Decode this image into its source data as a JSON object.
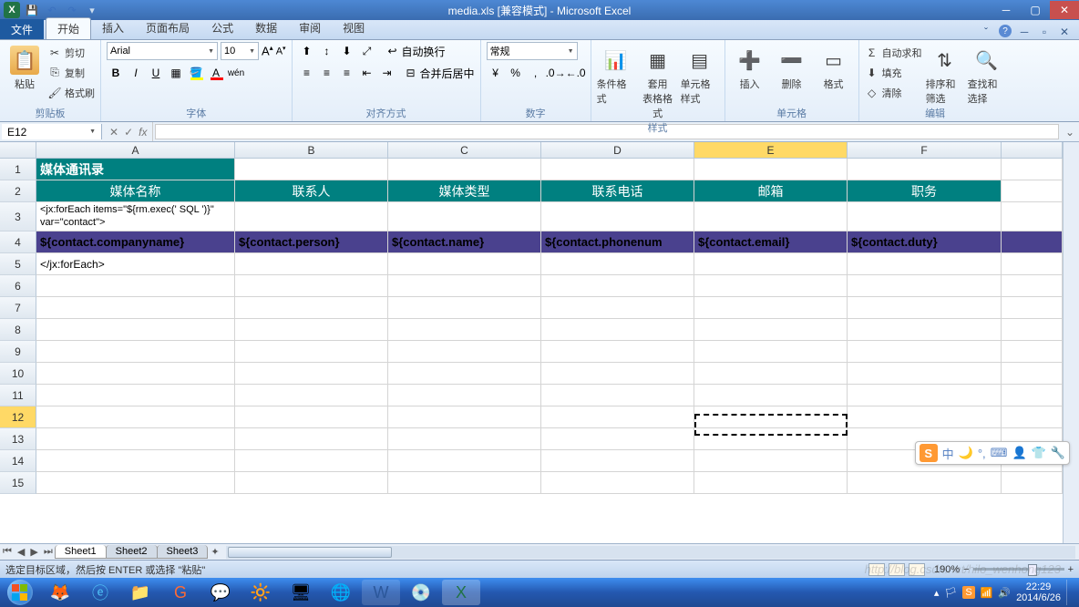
{
  "window": {
    "title": "media.xls [兼容模式] - Microsoft Excel"
  },
  "ribbon": {
    "file": "文件",
    "tabs": [
      "开始",
      "插入",
      "页面布局",
      "公式",
      "数据",
      "审阅",
      "视图"
    ],
    "active": 0,
    "groups": {
      "clipboard": {
        "label": "剪贴板",
        "paste": "粘贴",
        "cut": "剪切",
        "copy": "复制",
        "painter": "格式刷"
      },
      "font": {
        "label": "字体",
        "name": "Arial",
        "size": "10"
      },
      "align": {
        "label": "对齐方式",
        "wrap": "自动换行",
        "merge": "合并后居中"
      },
      "number": {
        "label": "数字",
        "format": "常规"
      },
      "styles": {
        "label": "样式",
        "cond": "条件格式",
        "table": "套用\n表格格式",
        "cell": "单元格样式"
      },
      "cells": {
        "label": "单元格",
        "insert": "插入",
        "delete": "删除",
        "format": "格式"
      },
      "editing": {
        "label": "编辑",
        "sum": "自动求和",
        "fill": "填充",
        "clear": "清除",
        "sort": "排序和筛选",
        "find": "查找和选择"
      }
    }
  },
  "formulaBar": {
    "nameBox": "E12",
    "fx": "fx",
    "value": ""
  },
  "grid": {
    "cols": [
      "A",
      "B",
      "C",
      "D",
      "E",
      "F"
    ],
    "selectedCol": "E",
    "selectedRow": 12,
    "rows": [
      {
        "n": 1,
        "h": 24,
        "cells": [
          {
            "t": "媒体通讯录",
            "cls": "teal"
          },
          {
            "t": ""
          },
          {
            "t": ""
          },
          {
            "t": ""
          },
          {
            "t": ""
          },
          {
            "t": ""
          }
        ]
      },
      {
        "n": 2,
        "h": 24,
        "cells": [
          {
            "t": "媒体名称",
            "cls": "teal-h"
          },
          {
            "t": "联系人",
            "cls": "teal-h"
          },
          {
            "t": "媒体类型",
            "cls": "teal-h"
          },
          {
            "t": "联系电话",
            "cls": "teal-h"
          },
          {
            "t": "邮箱",
            "cls": "teal-h"
          },
          {
            "t": "职务",
            "cls": "teal-h"
          }
        ]
      },
      {
        "n": 3,
        "h": 32,
        "cells": [
          {
            "t": "<jx:forEach items=\"${rm.exec(' SQL ')}\" var=\"contact\">",
            "wrap": true
          },
          {
            "t": ""
          },
          {
            "t": ""
          },
          {
            "t": ""
          },
          {
            "t": ""
          },
          {
            "t": ""
          }
        ]
      },
      {
        "n": 4,
        "h": 24,
        "cells": [
          {
            "t": "${contact.companyname}",
            "cls": "purple"
          },
          {
            "t": "${contact.person}",
            "cls": "purple"
          },
          {
            "t": "${contact.name}",
            "cls": "purple"
          },
          {
            "t": "${contact.phonenum",
            "cls": "purple"
          },
          {
            "t": "${contact.email}",
            "cls": "purple"
          },
          {
            "t": "${contact.duty}",
            "cls": "purple"
          }
        ]
      },
      {
        "n": 5,
        "h": 24,
        "cells": [
          {
            "t": "</jx:forEach>"
          },
          {
            "t": ""
          },
          {
            "t": ""
          },
          {
            "t": ""
          },
          {
            "t": ""
          },
          {
            "t": ""
          }
        ]
      },
      {
        "n": 6,
        "h": 24,
        "cells": [
          {
            "t": ""
          },
          {
            "t": ""
          },
          {
            "t": ""
          },
          {
            "t": ""
          },
          {
            "t": ""
          },
          {
            "t": ""
          }
        ]
      },
      {
        "n": 7,
        "h": 24,
        "cells": [
          {
            "t": ""
          },
          {
            "t": ""
          },
          {
            "t": ""
          },
          {
            "t": ""
          },
          {
            "t": ""
          },
          {
            "t": ""
          }
        ]
      },
      {
        "n": 8,
        "h": 24,
        "cells": [
          {
            "t": ""
          },
          {
            "t": ""
          },
          {
            "t": ""
          },
          {
            "t": ""
          },
          {
            "t": ""
          },
          {
            "t": ""
          }
        ]
      },
      {
        "n": 9,
        "h": 24,
        "cells": [
          {
            "t": ""
          },
          {
            "t": ""
          },
          {
            "t": ""
          },
          {
            "t": ""
          },
          {
            "t": ""
          },
          {
            "t": ""
          }
        ]
      },
      {
        "n": 10,
        "h": 24,
        "cells": [
          {
            "t": ""
          },
          {
            "t": ""
          },
          {
            "t": ""
          },
          {
            "t": ""
          },
          {
            "t": ""
          },
          {
            "t": ""
          }
        ]
      },
      {
        "n": 11,
        "h": 24,
        "cells": [
          {
            "t": ""
          },
          {
            "t": ""
          },
          {
            "t": ""
          },
          {
            "t": ""
          },
          {
            "t": ""
          },
          {
            "t": ""
          }
        ]
      },
      {
        "n": 12,
        "h": 24,
        "cells": [
          {
            "t": ""
          },
          {
            "t": ""
          },
          {
            "t": ""
          },
          {
            "t": ""
          },
          {
            "t": ""
          },
          {
            "t": ""
          }
        ]
      },
      {
        "n": 13,
        "h": 24,
        "cells": [
          {
            "t": ""
          },
          {
            "t": ""
          },
          {
            "t": ""
          },
          {
            "t": ""
          },
          {
            "t": ""
          },
          {
            "t": ""
          }
        ]
      },
      {
        "n": 14,
        "h": 24,
        "cells": [
          {
            "t": ""
          },
          {
            "t": ""
          },
          {
            "t": ""
          },
          {
            "t": ""
          },
          {
            "t": ""
          },
          {
            "t": ""
          }
        ]
      },
      {
        "n": 15,
        "h": 24,
        "cells": [
          {
            "t": ""
          },
          {
            "t": ""
          },
          {
            "t": ""
          },
          {
            "t": ""
          },
          {
            "t": ""
          },
          {
            "t": ""
          }
        ]
      }
    ]
  },
  "sheets": {
    "tabs": [
      "Sheet1",
      "Sheet2",
      "Sheet3"
    ],
    "active": 0
  },
  "statusbar": {
    "msg": "选定目标区域，然后按 ENTER 或选择 \"粘贴\"",
    "zoom": "190%"
  },
  "ime": {
    "label": "中"
  },
  "taskbar": {
    "time": "22:29",
    "date": "2014/6/26"
  },
  "watermark": "http://blog.csdn.net/hilo_wenhong123"
}
